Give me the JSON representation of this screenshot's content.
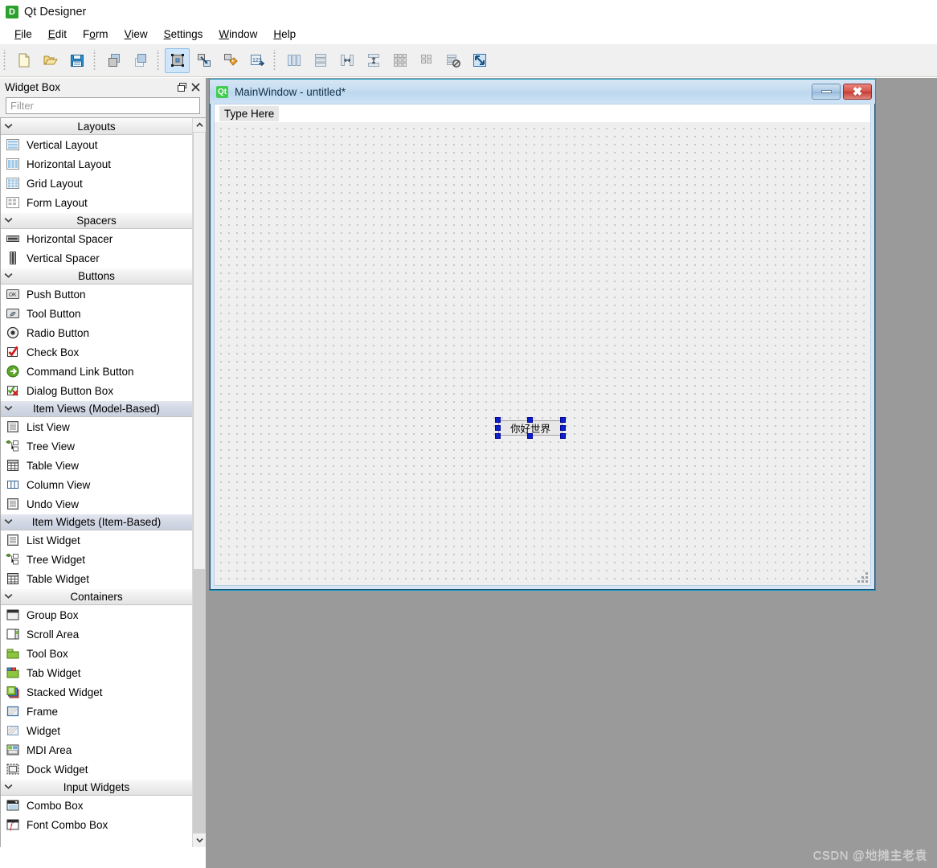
{
  "app": {
    "title": "Qt Designer",
    "logo_text": "D"
  },
  "menubar": {
    "items": [
      {
        "label": "File",
        "mnemonic": "F"
      },
      {
        "label": "Edit",
        "mnemonic": "E"
      },
      {
        "label": "Form",
        "mnemonic": "o"
      },
      {
        "label": "View",
        "mnemonic": "V"
      },
      {
        "label": "Settings",
        "mnemonic": "S"
      },
      {
        "label": "Window",
        "mnemonic": "W"
      },
      {
        "label": "Help",
        "mnemonic": "H"
      }
    ]
  },
  "toolbar": {
    "groups": [
      {
        "buttons": [
          {
            "name": "new-form-button",
            "icon": "new-file-icon",
            "active": false
          },
          {
            "name": "open-form-button",
            "icon": "open-folder-icon",
            "active": false
          },
          {
            "name": "save-form-button",
            "icon": "save-floppy-icon",
            "active": false
          }
        ]
      },
      {
        "buttons": [
          {
            "name": "undo-button",
            "icon": "undo-widgets-icon",
            "active": false
          },
          {
            "name": "redo-button",
            "icon": "redo-widgets-icon",
            "active": false
          }
        ]
      },
      {
        "buttons": [
          {
            "name": "edit-widgets-button",
            "icon": "edit-widgets-icon",
            "active": true
          },
          {
            "name": "edit-signals-slots-button",
            "icon": "edit-signals-slots-icon",
            "active": false
          },
          {
            "name": "edit-buddies-button",
            "icon": "edit-buddies-icon",
            "active": false
          },
          {
            "name": "edit-tab-order-button",
            "icon": "edit-tab-order-icon",
            "active": false
          }
        ]
      },
      {
        "buttons": [
          {
            "name": "layout-horizontally-button",
            "icon": "layout-horizontal-icon",
            "active": false
          },
          {
            "name": "layout-vertically-button",
            "icon": "layout-vertical-icon",
            "active": false
          },
          {
            "name": "layout-splitter-horizontal-button",
            "icon": "splitter-horizontal-icon",
            "active": false
          },
          {
            "name": "layout-splitter-vertical-button",
            "icon": "splitter-vertical-icon",
            "active": false
          },
          {
            "name": "layout-grid-button",
            "icon": "layout-grid-icon",
            "active": false
          },
          {
            "name": "layout-form-button",
            "icon": "layout-form-icon",
            "active": false
          },
          {
            "name": "break-layout-button",
            "icon": "break-layout-icon",
            "active": false
          },
          {
            "name": "adjust-size-button",
            "icon": "adjust-size-icon",
            "active": false
          }
        ]
      }
    ]
  },
  "widget_box": {
    "title": "Widget Box",
    "float_icon": "float-dock-icon",
    "close_icon": "close-icon",
    "filter_placeholder": "Filter",
    "filter_value": "",
    "scroll": {
      "up_arrow": "chevron-up-icon",
      "down_arrow": "chevron-down-icon"
    },
    "categories": [
      {
        "label": "Layouts",
        "expanded": true,
        "selected": false,
        "items": [
          {
            "label": "Vertical Layout",
            "icon": "vertical-layout-icon"
          },
          {
            "label": "Horizontal Layout",
            "icon": "horizontal-layout-icon"
          },
          {
            "label": "Grid Layout",
            "icon": "grid-layout-icon"
          },
          {
            "label": "Form Layout",
            "icon": "form-layout-icon"
          }
        ]
      },
      {
        "label": "Spacers",
        "expanded": true,
        "selected": false,
        "items": [
          {
            "label": "Horizontal Spacer",
            "icon": "horizontal-spacer-icon"
          },
          {
            "label": "Vertical Spacer",
            "icon": "vertical-spacer-icon"
          }
        ]
      },
      {
        "label": "Buttons",
        "expanded": true,
        "selected": false,
        "items": [
          {
            "label": "Push Button",
            "icon": "push-button-icon"
          },
          {
            "label": "Tool Button",
            "icon": "tool-button-icon"
          },
          {
            "label": "Radio Button",
            "icon": "radio-button-icon"
          },
          {
            "label": "Check Box",
            "icon": "check-box-icon"
          },
          {
            "label": "Command Link Button",
            "icon": "command-link-button-icon"
          },
          {
            "label": "Dialog Button Box",
            "icon": "dialog-button-box-icon"
          }
        ]
      },
      {
        "label": "Item Views (Model-Based)",
        "expanded": true,
        "selected": true,
        "items": [
          {
            "label": "List View",
            "icon": "list-view-icon"
          },
          {
            "label": "Tree View",
            "icon": "tree-view-icon"
          },
          {
            "label": "Table View",
            "icon": "table-view-icon"
          },
          {
            "label": "Column View",
            "icon": "column-view-icon"
          },
          {
            "label": "Undo View",
            "icon": "undo-view-icon"
          }
        ]
      },
      {
        "label": "Item Widgets (Item-Based)",
        "expanded": true,
        "selected": true,
        "items": [
          {
            "label": "List Widget",
            "icon": "list-widget-icon"
          },
          {
            "label": "Tree Widget",
            "icon": "tree-widget-icon"
          },
          {
            "label": "Table Widget",
            "icon": "table-widget-icon"
          }
        ]
      },
      {
        "label": "Containers",
        "expanded": true,
        "selected": false,
        "items": [
          {
            "label": "Group Box",
            "icon": "group-box-icon"
          },
          {
            "label": "Scroll Area",
            "icon": "scroll-area-icon"
          },
          {
            "label": "Tool Box",
            "icon": "tool-box-icon"
          },
          {
            "label": "Tab Widget",
            "icon": "tab-widget-icon"
          },
          {
            "label": "Stacked Widget",
            "icon": "stacked-widget-icon"
          },
          {
            "label": "Frame",
            "icon": "frame-icon"
          },
          {
            "label": "Widget",
            "icon": "widget-icon"
          },
          {
            "label": "MDI Area",
            "icon": "mdi-area-icon"
          },
          {
            "label": "Dock Widget",
            "icon": "dock-widget-icon"
          }
        ]
      },
      {
        "label": "Input Widgets",
        "expanded": true,
        "selected": false,
        "items": [
          {
            "label": "Combo Box",
            "icon": "combo-box-icon"
          },
          {
            "label": "Font Combo Box",
            "icon": "font-combo-box-icon"
          }
        ]
      }
    ]
  },
  "form_window": {
    "logo_text": "Qt",
    "title": "MainWindow - untitled*",
    "minimize_label": "minimize-icon",
    "close_label": "✖",
    "menu_placeholder": "Type Here",
    "selected_widget": {
      "text": "你好世界",
      "handle_count": 8
    }
  },
  "watermark": {
    "text": "CSDN @地摊主老袁"
  },
  "colors": {
    "accent": "#0b22c8",
    "qt_green": "#41cd52",
    "close_red": "#c63a31",
    "titlebar_blue": "#c4dcf0",
    "canvas_bg": "#efefef",
    "editor_bg": "#9a9a9a"
  }
}
